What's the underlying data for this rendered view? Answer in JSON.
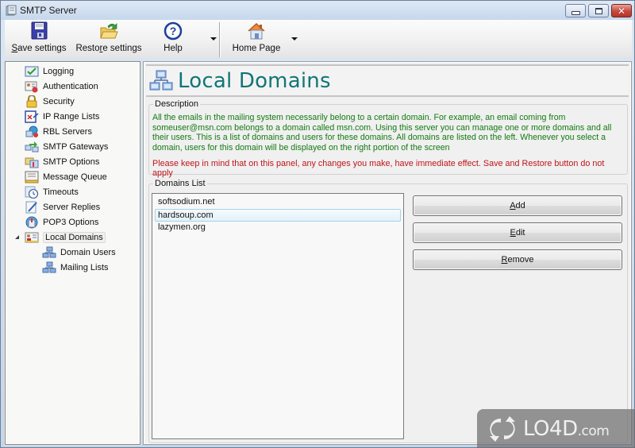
{
  "window": {
    "title": "SMTP Server",
    "controls": {
      "minimize": "minimize",
      "maximize": "maximize",
      "close": "close"
    }
  },
  "toolbar": {
    "buttons": [
      {
        "label": "Save settings",
        "mnemonic": "S",
        "icon": "floppy-disk-icon"
      },
      {
        "label": "Restore settings",
        "mnemonic": "e",
        "icon": "folder-restore-icon"
      },
      {
        "label": "Help",
        "icon": "help-icon",
        "has_dropdown": true
      },
      {
        "label": "Home Page",
        "icon": "home-icon",
        "has_dropdown": true
      }
    ]
  },
  "tree": {
    "items": [
      {
        "label": "Logging",
        "icon": "logging-icon",
        "level": 1
      },
      {
        "label": "Authentication",
        "icon": "authentication-icon",
        "level": 1
      },
      {
        "label": "Security",
        "icon": "lock-icon",
        "level": 1
      },
      {
        "label": "IP Range Lists",
        "icon": "ip-range-icon",
        "level": 1
      },
      {
        "label": "RBL Servers",
        "icon": "rbl-servers-icon",
        "level": 1
      },
      {
        "label": "SMTP Gateways",
        "icon": "gateway-icon",
        "level": 1
      },
      {
        "label": "SMTP Options",
        "icon": "smtp-options-icon",
        "level": 1
      },
      {
        "label": "Message Queue",
        "icon": "message-queue-icon",
        "level": 1
      },
      {
        "label": "Timeouts",
        "icon": "clock-icon",
        "level": 1
      },
      {
        "label": "Server Replies",
        "icon": "server-replies-icon",
        "level": 1
      },
      {
        "label": "POP3 Options",
        "icon": "pop3-icon",
        "level": 1
      },
      {
        "label": "Local Domains",
        "icon": "local-domains-icon",
        "level": 1,
        "selected": true,
        "expanded": true
      },
      {
        "label": "Domain Users",
        "icon": "network-icon",
        "level": 2
      },
      {
        "label": "Mailing Lists",
        "icon": "network-icon",
        "level": 2
      }
    ]
  },
  "main": {
    "title": "Local Domains",
    "title_color": "#127575",
    "description": {
      "legend": "Description",
      "text": "All the emails in the mailing system necessarily belong to a certain domain. For example, an email coming from someuser@msn.com belongs to a domain called msn.com. Using this server you can manage one or more domains and all their users. This is a list of domains and users for these domains. All domains are listed on the left. Whenever you select a domain, users for this domain will be displayed on the right portion of the screen",
      "text_color": "#127a12",
      "warning": "Please keep in mind that on this panel, any changes you make, have immediate effect. Save and Restore button do not apply",
      "warning_color": "#c0141a"
    },
    "domains": {
      "legend": "Domains List",
      "items": [
        {
          "name": "softsodium.net",
          "selected": false
        },
        {
          "name": "hardsoup.com",
          "selected": true
        },
        {
          "name": "lazymen.org",
          "selected": false
        }
      ]
    },
    "actions": [
      {
        "label": "Add",
        "mnemonic": "A"
      },
      {
        "label": "Edit",
        "mnemonic": "E"
      },
      {
        "label": "Remove",
        "mnemonic": "R"
      }
    ]
  },
  "watermark": {
    "text": "LO4D",
    "suffix": ".com"
  }
}
